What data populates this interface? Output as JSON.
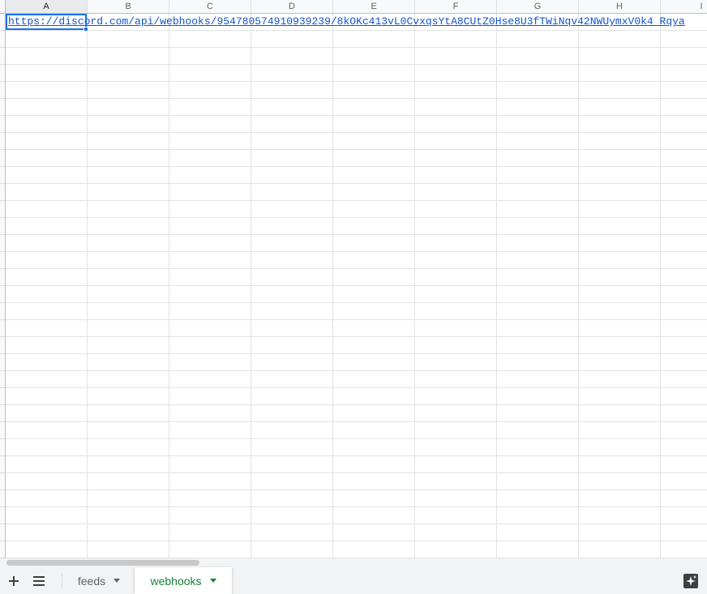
{
  "columns": [
    "A",
    "B",
    "C",
    "D",
    "E",
    "F",
    "G",
    "H",
    "I"
  ],
  "selected_column": "A",
  "cell_a1": {
    "address": "A1",
    "value": "https://discord.com/api/webhooks/954780574910939239/8kOKc413vL0CvxqsYtA8CUtZ0Hse8U3fTWiNqv42NWUymxV0k4_Rqya"
  },
  "sheet_tabs": [
    {
      "label": "feeds",
      "active": false
    },
    {
      "label": "webhooks",
      "active": true
    }
  ],
  "icons": {
    "add_sheet": "plus-icon",
    "all_sheets": "list-icon",
    "explore": "explore-sparkle-icon"
  },
  "colors": {
    "link": "#1155cc",
    "selection": "#1a73e8",
    "active_tab": "#188038"
  }
}
